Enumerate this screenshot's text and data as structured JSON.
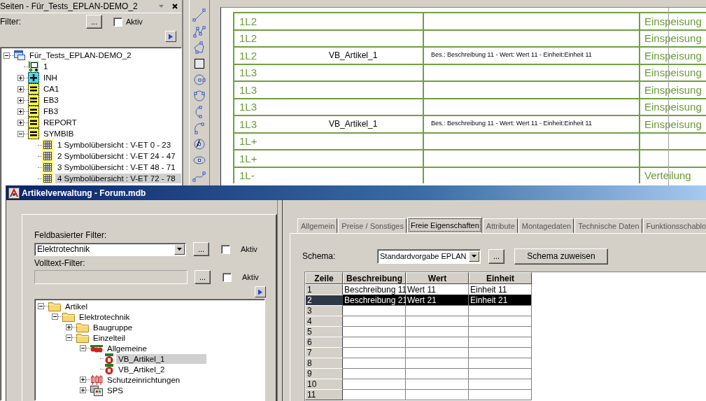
{
  "pages_panel": {
    "title": "Seiten - Für_Tests_EPLAN-DEMO_2",
    "filter": {
      "label": "Filter:",
      "button": "...",
      "aktiv": {
        "label": "Aktiv",
        "checked": false
      }
    },
    "tree": [
      {
        "label": "Für_Tests_EPLAN-DEMO_2",
        "kind": "project",
        "expanded": true,
        "selected": false,
        "children": [
          {
            "label": "1",
            "kind": "station",
            "selected": false
          },
          {
            "label": "INH",
            "kind": "plus-node",
            "expanded": false,
            "selected": false
          },
          {
            "label": "CA1",
            "kind": "node",
            "expanded": false,
            "selected": false
          },
          {
            "label": "EB3",
            "kind": "node",
            "expanded": false,
            "selected": false
          },
          {
            "label": "FB3",
            "kind": "node",
            "expanded": false,
            "selected": false
          },
          {
            "label": "REPORT",
            "kind": "node",
            "expanded": false,
            "selected": false
          },
          {
            "label": "SYMBIB",
            "kind": "node",
            "expanded": true,
            "selected": false,
            "children": [
              {
                "label": "1 Symbolübersicht : V-ET 0 - 23",
                "kind": "grid-page",
                "selected": false
              },
              {
                "label": "2 Symbolübersicht : V-ET 24 - 47",
                "kind": "grid-page",
                "selected": false
              },
              {
                "label": "3 Symbolübersicht : V-ET 48 - 71",
                "kind": "grid-page",
                "selected": false
              },
              {
                "label": "4 Symbolübersicht : V-ET 72 - 78",
                "kind": "grid-page",
                "selected": true
              }
            ]
          }
        ]
      }
    ]
  },
  "schematic_table": {
    "rows": [
      {
        "column_1": "1L2",
        "column_4": "Einspeisung"
      },
      {
        "column_1": "1L2",
        "column_4": "Einspeisung"
      },
      {
        "column_1": "1L2",
        "column_2": "VB_Artikel_1",
        "column_3": "Bes.: Beschreibung 11 - Wert: Wert 11 - Einheit:Einheit 11",
        "column_4": "Einspeisung"
      },
      {
        "column_1": "1L3",
        "column_4": "Einspeisung"
      },
      {
        "column_1": "1L3",
        "column_4": "Einspeisung"
      },
      {
        "column_1": "1L3",
        "column_4": "Einspeisung"
      },
      {
        "column_1": "1L3",
        "column_2": "VB_Artikel_1",
        "column_3": "Bes.: Beschreibung 11 - Wert: Wert 11 - Einheit:Einheit 11",
        "column_4": "Einspeisung"
      },
      {
        "column_1": "1L+"
      },
      {
        "column_1": "1L+"
      },
      {
        "column_1": "1L-",
        "column_4": "Verteilung"
      }
    ]
  },
  "dialog": {
    "title": "Artikelverwaltung - Forum.mdb",
    "filters": [
      {
        "label": "Feldbasierter Filter:",
        "kind": "combo",
        "value": "Elektrotechnik",
        "disabled": false,
        "button": "...",
        "aktiv": {
          "label": "Aktiv",
          "checked": false
        }
      },
      {
        "label": "Volltext-Filter:",
        "kind": "text",
        "disabled": true,
        "button": "...",
        "aktiv": {
          "label": "Aktiv",
          "checked": false
        }
      }
    ],
    "tree": [
      {
        "label": "Artikel",
        "kind": "folder",
        "expanded": true,
        "selected": false,
        "children": [
          {
            "label": "Elektrotechnik",
            "kind": "folder",
            "expanded": true,
            "selected": false,
            "children": [
              {
                "label": "Baugruppe",
                "kind": "folder",
                "expanded": false,
                "selected": false
              },
              {
                "label": "Einzelteil",
                "kind": "folder",
                "expanded": true,
                "selected": false,
                "children": [
                  {
                    "label": "Allgemeine",
                    "kind": "part-group",
                    "expanded": true,
                    "selected": false,
                    "children": [
                      {
                        "label": "VB_Artikel_1",
                        "kind": "part",
                        "selected": true
                      },
                      {
                        "label": "VB_Artikel_2",
                        "kind": "part",
                        "selected": false
                      }
                    ]
                  },
                  {
                    "label": "Schutzeinrichtungen",
                    "kind": "protection",
                    "expanded": false,
                    "selected": false
                  },
                  {
                    "label": "SPS",
                    "kind": "plc",
                    "expanded": false,
                    "selected": false
                  }
                ]
              }
            ]
          }
        ]
      }
    ],
    "tabs": [
      {
        "label": "Allgemein",
        "selected": false
      },
      {
        "label": "Preise / Sonstiges",
        "selected": false
      },
      {
        "label": "Freie Eigenschaften",
        "selected": true
      },
      {
        "label": "Attribute",
        "selected": false
      },
      {
        "label": "Montagedaten",
        "selected": false
      },
      {
        "label": "Technische Daten",
        "selected": false
      },
      {
        "label": "Funktionsschablo",
        "selected": false
      }
    ],
    "schema": {
      "label": "Schema:",
      "value": "Standardvorgabe EPLAN",
      "browse_button": "...",
      "assign_button": "Schema zuweisen"
    },
    "grid": {
      "columns": [
        "Zeile",
        "Beschreibung",
        "Wert",
        "Einheit"
      ],
      "rows": [
        {
          "number": "1",
          "cells": [
            "Beschreibung 11",
            "Wert 11",
            "Einheit 11"
          ],
          "selected": false
        },
        {
          "number": "2",
          "cells": [
            "Beschreibung 21",
            "Wert 21",
            "Einheit 21"
          ],
          "selected": true
        },
        {
          "number": "3",
          "selected": false
        },
        {
          "number": "4",
          "selected": false
        },
        {
          "number": "5",
          "selected": false
        },
        {
          "number": "6",
          "selected": false
        },
        {
          "number": "7",
          "selected": false
        },
        {
          "number": "8",
          "selected": false
        },
        {
          "number": "9",
          "selected": false
        },
        {
          "number": "10",
          "selected": false
        },
        {
          "number": "11",
          "selected": false
        }
      ]
    }
  }
}
